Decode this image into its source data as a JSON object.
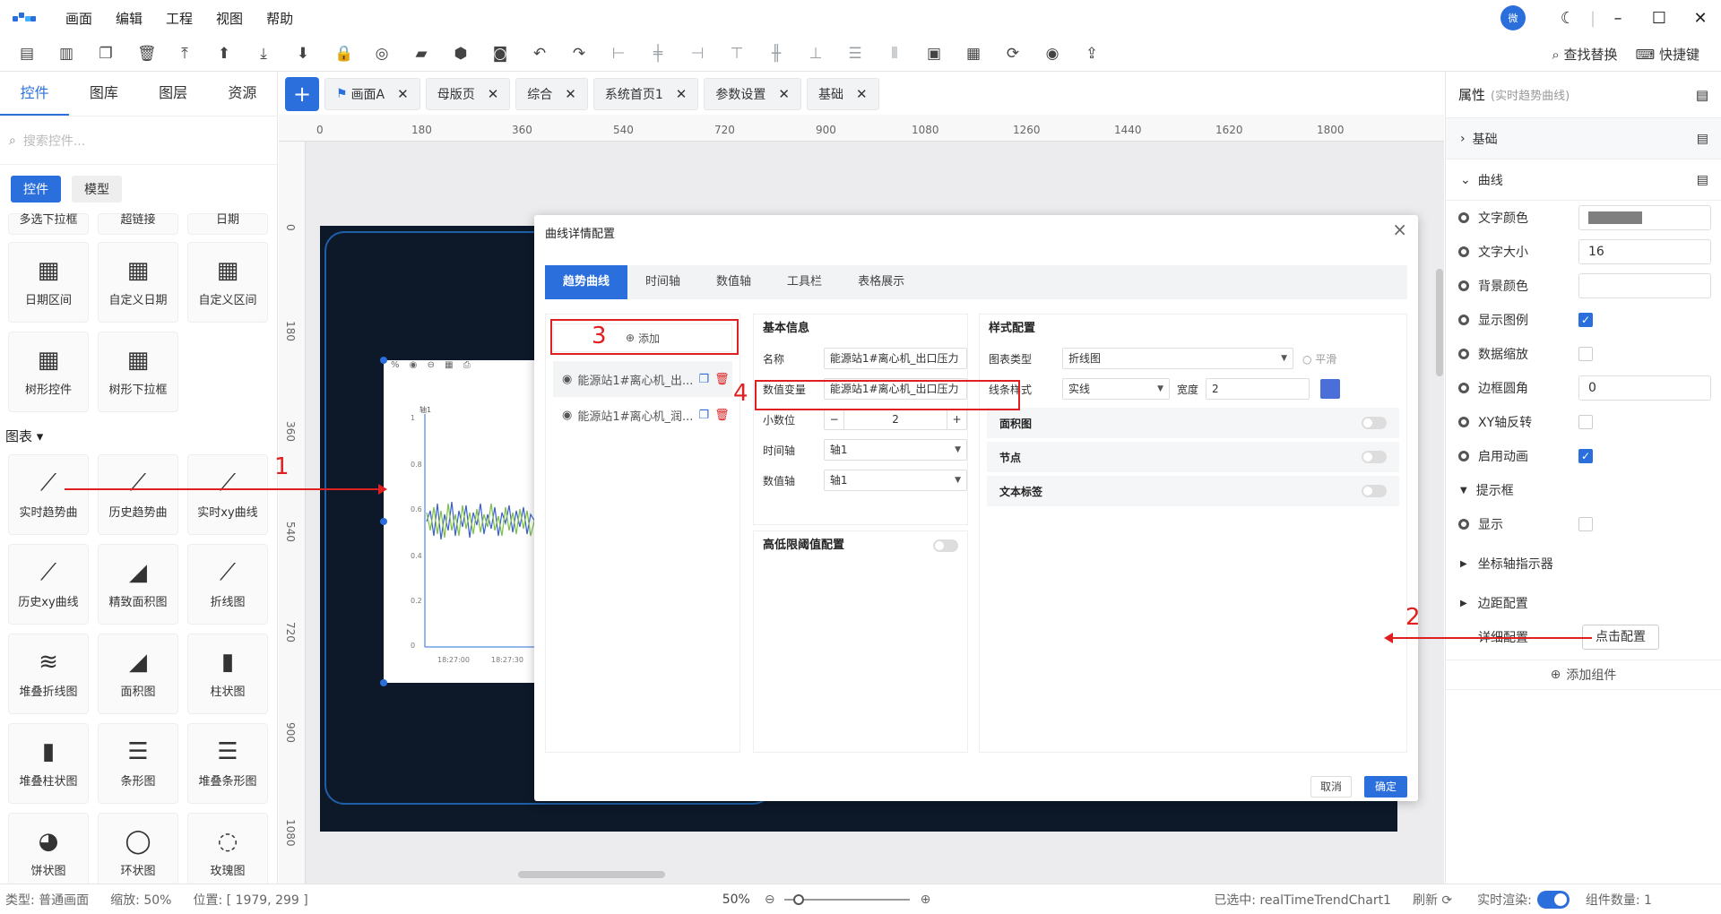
{
  "menubar": {
    "items": [
      "画面",
      "编辑",
      "工程",
      "视图",
      "帮助"
    ],
    "avatar": "微"
  },
  "toolbar_right": {
    "find_replace": "查找替换",
    "shortcuts": "快捷键"
  },
  "left": {
    "tabs": [
      "控件",
      "图库",
      "图层",
      "资源"
    ],
    "search_placeholder": "搜索控件...",
    "subtabs": [
      "控件",
      "模型"
    ],
    "partial_row": [
      "多选下拉框",
      "超链接",
      "日期"
    ],
    "date_items": [
      "日期区间",
      "自定义日期",
      "自定义区间"
    ],
    "tree_items": [
      "树形控件",
      "树形下拉框"
    ],
    "chart_section": "图表",
    "chart_items": [
      "实时趋势曲",
      "历史趋势曲",
      "实时xy曲线",
      "历史xy曲线",
      "精致面积图",
      "折线图",
      "堆叠折线图",
      "面积图",
      "柱状图",
      "堆叠柱状图",
      "条形图",
      "堆叠条形图",
      "饼状图",
      "环状图",
      "玫瑰图"
    ]
  },
  "doctabs": [
    {
      "label": "画面A"
    },
    {
      "label": "母版页"
    },
    {
      "label": "综合"
    },
    {
      "label": "系统首页1"
    },
    {
      "label": "参数设置"
    },
    {
      "label": "基础"
    }
  ],
  "ruler": {
    "h": [
      "0",
      "180",
      "360",
      "540",
      "720",
      "900",
      "1080",
      "1260",
      "1440",
      "1620",
      "1800"
    ],
    "v": [
      "0",
      "180",
      "360",
      "540",
      "720",
      "900",
      "1080"
    ]
  },
  "modal": {
    "title": "曲线详情配置",
    "tabs": [
      "趋势曲线",
      "时间轴",
      "数值轴",
      "工具栏",
      "表格展示"
    ],
    "add_label": "添加",
    "curves": [
      "能源站1#离心机_出...",
      "能源站1#离心机_润..."
    ],
    "basic": {
      "title": "基本信息",
      "name_label": "名称",
      "name_value": "能源站1#离心机_出口压力",
      "var_label": "数值变量",
      "var_value": "能源站1#离心机_出口压力",
      "decimal_label": "小数位",
      "decimal_value": "2",
      "time_axis_label": "时间轴",
      "time_axis_value": "轴1",
      "value_axis_label": "数值轴",
      "value_axis_value": "轴1"
    },
    "threshold_title": "高低限阈值配置",
    "style": {
      "title": "样式配置",
      "chart_type_label": "图表类型",
      "chart_type_value": "折线图",
      "smooth_label": "平滑",
      "line_style_label": "线条样式",
      "line_style_value": "实线",
      "width_label": "宽度",
      "width_value": "2",
      "line_color": "#4a6fd8",
      "options": [
        "面积图",
        "节点",
        "文本标签"
      ]
    },
    "cancel": "取消",
    "ok": "确定"
  },
  "right": {
    "title": "属性",
    "subtitle": "(实时趋势曲线)",
    "sections": [
      "基础",
      "曲线"
    ],
    "rows": [
      {
        "label": "文字颜色"
      },
      {
        "label": "文字大小",
        "value": "16"
      },
      {
        "label": "背景颜色"
      },
      {
        "label": "显示图例"
      },
      {
        "label": "数据缩放"
      },
      {
        "label": "边框圆角",
        "value": "0"
      },
      {
        "label": "XY轴反转"
      },
      {
        "label": "启用动画"
      }
    ],
    "tooltip_section": "提示框",
    "tooltip_show": "显示",
    "axis_indicator": "坐标轴指示器",
    "margin_config": "边距配置",
    "detail_config": "详细配置",
    "detail_button": "点击配置",
    "add_component": "添加组件",
    "text_color": "#7f7f7f"
  },
  "annotations": [
    "1",
    "2",
    "3",
    "4"
  ],
  "chart_preview": {
    "y_axis_label": "轴1",
    "y_ticks": [
      "1",
      "0.8",
      "0.6",
      "0.4",
      "0.2",
      "0"
    ],
    "x_ticks": [
      "18:27:00",
      "18:27:30"
    ]
  },
  "status": {
    "type": "类型: 普通画面",
    "zoom": "缩放: 50%",
    "position": "位置: [ 1979, 299 ]",
    "zoom_value": "50%",
    "selected": "已选中: realTimeTrendChart1",
    "refresh": "刷新",
    "realtime": "实时渲染:",
    "count": "组件数量: 1"
  },
  "colors": {
    "accent": "#2a6fdb",
    "annotation": "#e02020",
    "canvas_dark": "#0d1829"
  }
}
